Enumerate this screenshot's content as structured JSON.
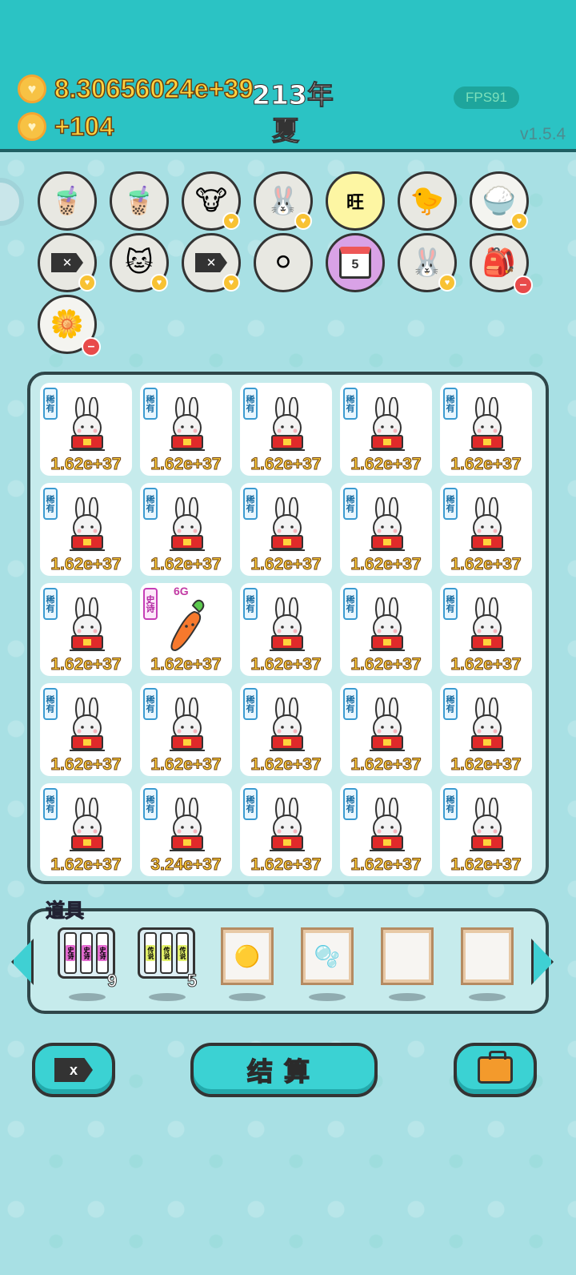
{
  "header": {
    "money": "8.30656024e+39",
    "income": "+104",
    "year": "213年",
    "season": "夏",
    "fps": "FPS91",
    "version": "v1.5.4"
  },
  "items": [
    {
      "name": "milk-tea-icon",
      "glyph": "🧋",
      "badge": "none"
    },
    {
      "name": "milk-tea-icon",
      "glyph": "🧋",
      "badge": "none"
    },
    {
      "name": "cow-pair-icon",
      "glyph": "🐮",
      "badge": "heart"
    },
    {
      "name": "bunny-icon",
      "glyph": "🐰",
      "badge": "heart"
    },
    {
      "name": "wang-charm-icon",
      "glyph": "旺",
      "badge": "none",
      "style": "yellow"
    },
    {
      "name": "chicken-egg-icon",
      "glyph": "🐤",
      "badge": "none"
    },
    {
      "name": "rice-bowl-icon",
      "glyph": "🍚",
      "badge": "heart",
      "style": "white"
    },
    {
      "name": "x-tag-icon",
      "glyph": "x",
      "badge": "heart"
    },
    {
      "name": "cat-pair-icon",
      "glyph": "🐱",
      "badge": "heart"
    },
    {
      "name": "x-tag-icon",
      "glyph": "x",
      "badge": "heart"
    },
    {
      "name": "egg-tray-icon",
      "glyph": "⚪",
      "badge": "none"
    },
    {
      "name": "calendar-icon",
      "glyph": "5",
      "badge": "none",
      "style": "purple"
    },
    {
      "name": "bunny-icon",
      "glyph": "🐰",
      "badge": "heart"
    },
    {
      "name": "sack-icon",
      "glyph": "🎒",
      "badge": "minus"
    },
    {
      "name": "flower-pot-icon",
      "glyph": "🌼",
      "badge": "minus",
      "style": "white"
    }
  ],
  "grid": [
    [
      {
        "tag": "稀有",
        "kind": "bunny",
        "value": "1.62e+37"
      },
      {
        "tag": "稀有",
        "kind": "bunny",
        "value": "1.62e+37"
      },
      {
        "tag": "稀有",
        "kind": "bunny",
        "value": "1.62e+37"
      },
      {
        "tag": "稀有",
        "kind": "bunny",
        "value": "1.62e+37"
      },
      {
        "tag": "稀有",
        "kind": "bunny",
        "value": "1.62e+37"
      }
    ],
    [
      {
        "tag": "稀有",
        "kind": "bunny",
        "value": "1.62e+37"
      },
      {
        "tag": "稀有",
        "kind": "bunny",
        "value": "1.62e+37"
      },
      {
        "tag": "稀有",
        "kind": "bunny",
        "value": "1.62e+37"
      },
      {
        "tag": "稀有",
        "kind": "bunny",
        "value": "1.62e+37"
      },
      {
        "tag": "稀有",
        "kind": "bunny",
        "value": "1.62e+37"
      }
    ],
    [
      {
        "tag": "稀有",
        "kind": "bunny",
        "value": "1.62e+37"
      },
      {
        "tag": "史诗",
        "kind": "carrot",
        "value": "1.62e+37",
        "extra": "6G"
      },
      {
        "tag": "稀有",
        "kind": "bunny",
        "value": "1.62e+37"
      },
      {
        "tag": "稀有",
        "kind": "bunny",
        "value": "1.62e+37"
      },
      {
        "tag": "稀有",
        "kind": "bunny",
        "value": "1.62e+37"
      }
    ],
    [
      {
        "tag": "稀有",
        "kind": "bunny",
        "value": "1.62e+37"
      },
      {
        "tag": "稀有",
        "kind": "bunny",
        "value": "1.62e+37"
      },
      {
        "tag": "稀有",
        "kind": "bunny",
        "value": "1.62e+37"
      },
      {
        "tag": "稀有",
        "kind": "bunny",
        "value": "1.62e+37"
      },
      {
        "tag": "稀有",
        "kind": "bunny",
        "value": "1.62e+37"
      }
    ],
    [
      {
        "tag": "稀有",
        "kind": "bunny",
        "value": "1.62e+37"
      },
      {
        "tag": "稀有",
        "kind": "bunny",
        "value": "3.24e+37"
      },
      {
        "tag": "稀有",
        "kind": "bunny",
        "value": "1.62e+37"
      },
      {
        "tag": "稀有",
        "kind": "bunny",
        "value": "1.62e+37"
      },
      {
        "tag": "稀有",
        "kind": "bunny",
        "value": "1.62e+37"
      }
    ]
  ],
  "props": {
    "label": "道具",
    "slots": [
      {
        "name": "epic-tubes-prop",
        "type": "tubes",
        "tube_label": "史诗",
        "tube_color": "#e36bd0",
        "count": "9"
      },
      {
        "name": "rare-tubes-prop",
        "type": "tubes",
        "tube_label": "传说",
        "tube_color": "#e2f06a",
        "count": "5"
      },
      {
        "name": "gold-balls-prop",
        "type": "frame",
        "glyph": "🟡"
      },
      {
        "name": "capsule-prop",
        "type": "frame",
        "glyph": "🫧"
      },
      {
        "name": "empty-frame-prop",
        "type": "frame",
        "glyph": ""
      },
      {
        "name": "empty-frame-prop",
        "type": "frame",
        "glyph": ""
      }
    ]
  },
  "buttons": {
    "remove": "x",
    "settle": "结算"
  },
  "colors": {
    "header_bg": "#2bc3c4",
    "accent": "#3bd2d3",
    "coin": "#f7c244",
    "value_text": "#ffce3a"
  }
}
